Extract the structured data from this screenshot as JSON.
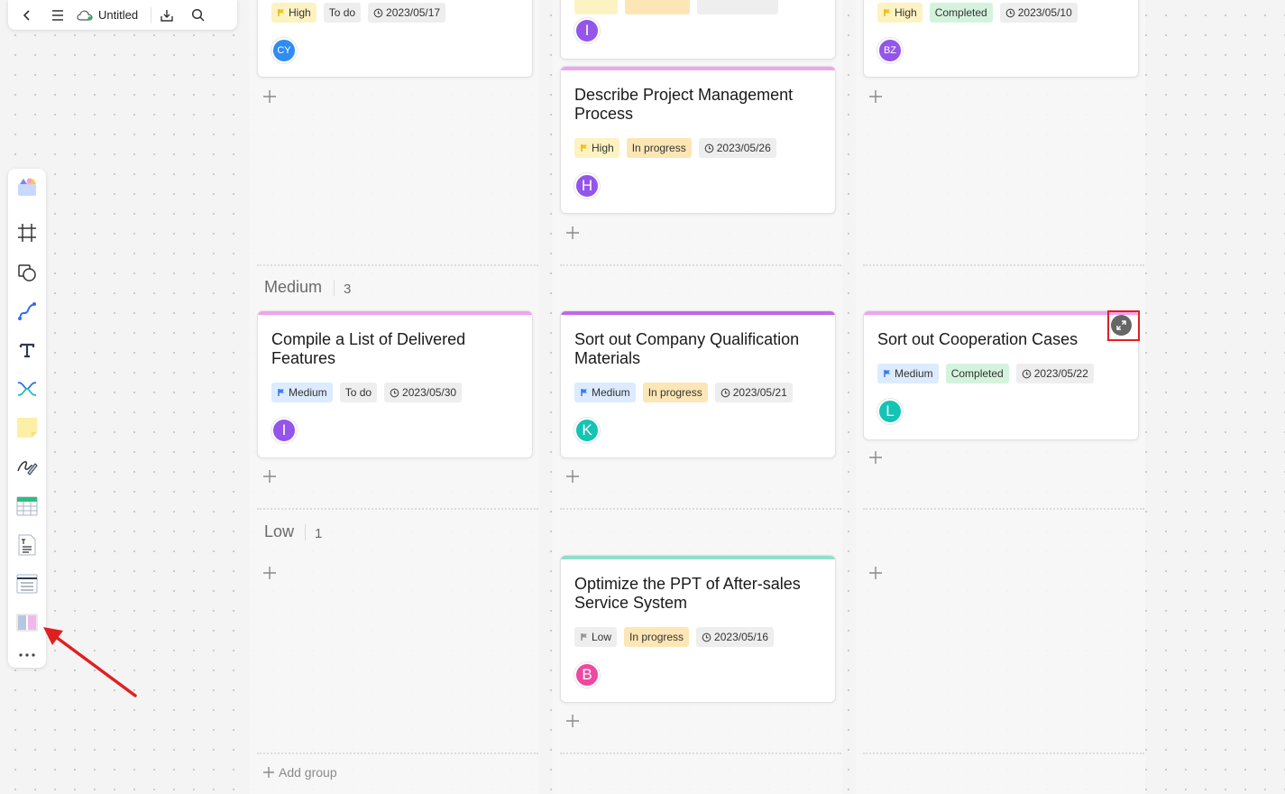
{
  "topbar": {
    "title": "Untitled"
  },
  "columns": [
    {
      "cards": [
        {
          "title": "",
          "priority": "High",
          "status": "To do",
          "date": "2023/05/17",
          "avatar": "CY",
          "avatar_color": "#2f8cf3"
        },
        {
          "title": "Compile a List of Delivered Features",
          "priority": "Medium",
          "status": "To do",
          "date": "2023/05/30",
          "avatar": "I",
          "avatar_color": "#9355ea"
        }
      ]
    },
    {
      "cards": [
        {
          "title": "",
          "avatar": "I",
          "avatar_color": "#9355ea"
        },
        {
          "title": "Describe Project Management Process",
          "priority": "High",
          "status": "In progress",
          "date": "2023/05/26",
          "avatar": "H",
          "avatar_color": "#9355ea"
        },
        {
          "title": "Sort out Company Qualification Materials",
          "priority": "Medium",
          "status": "In progress",
          "date": "2023/05/21",
          "avatar": "K",
          "avatar_color": "#14c4b4"
        },
        {
          "title": "Optimize the PPT of After-sales Service System",
          "priority": "Low",
          "status": "In progress",
          "date": "2023/05/16",
          "avatar": "B",
          "avatar_color": "#ec4aa0"
        }
      ]
    },
    {
      "cards": [
        {
          "title": "",
          "priority": "High",
          "status": "Completed",
          "date": "2023/05/10",
          "avatar": "BZ",
          "avatar_color": "#9355ea"
        },
        {
          "title": "Sort out Cooperation Cases",
          "priority": "Medium",
          "status": "Completed",
          "date": "2023/05/22",
          "avatar": "L",
          "avatar_color": "#14c4b4"
        }
      ]
    }
  ],
  "groups": [
    {
      "label": "Medium",
      "count": "3"
    },
    {
      "label": "Low",
      "count": "1"
    }
  ],
  "add_group_label": "Add group",
  "colors": {
    "bar_pink": "#f0a3ef",
    "bar_purple": "#c267ea",
    "bar_teal": "#8ee0cb",
    "highlight": "#e02020",
    "arrow": "#e02020"
  },
  "left_tools": [
    "templates-icon",
    "frame-icon",
    "shape-icon",
    "connector-icon",
    "text-icon",
    "mindmap-icon",
    "sticky-note-icon",
    "pen-icon",
    "table-icon",
    "document-icon",
    "list-icon",
    "kanban-icon",
    "more-icon"
  ]
}
